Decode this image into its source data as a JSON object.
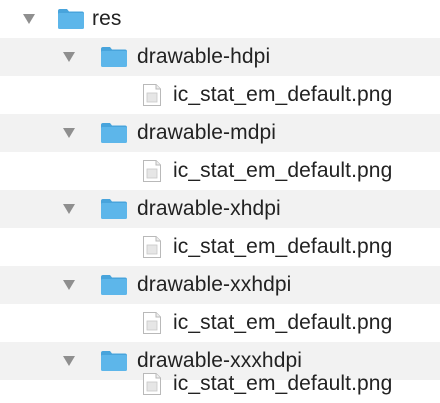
{
  "tree": {
    "root": {
      "label": "res",
      "icon": "folder-icon",
      "expanded": true
    },
    "folders": [
      {
        "label": "drawable-hdpi",
        "icon": "folder-icon",
        "expanded": true,
        "file": {
          "label": "ic_stat_em_default.png",
          "icon": "png-file-icon"
        }
      },
      {
        "label": "drawable-mdpi",
        "icon": "folder-icon",
        "expanded": true,
        "file": {
          "label": "ic_stat_em_default.png",
          "icon": "png-file-icon"
        }
      },
      {
        "label": "drawable-xhdpi",
        "icon": "folder-icon",
        "expanded": true,
        "file": {
          "label": "ic_stat_em_default.png",
          "icon": "png-file-icon"
        }
      },
      {
        "label": "drawable-xxhdpi",
        "icon": "folder-icon",
        "expanded": true,
        "file": {
          "label": "ic_stat_em_default.png",
          "icon": "png-file-icon"
        }
      },
      {
        "label": "drawable-xxxhdpi",
        "icon": "folder-icon",
        "expanded": true,
        "file": {
          "label": "ic_stat_em_default.png",
          "icon": "png-file-icon"
        }
      }
    ]
  },
  "colors": {
    "folder_body": "#5db6ea",
    "folder_tab": "#48a4dc",
    "stripe": "#f2f2f2",
    "disclosure": "#8f8f8f"
  }
}
